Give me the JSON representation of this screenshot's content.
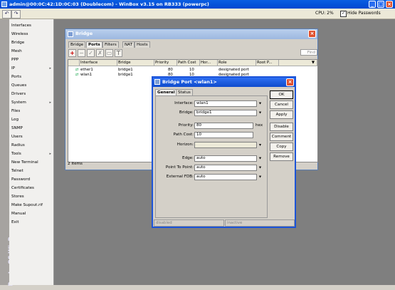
{
  "window": {
    "title": "admin@00:0C:42:1D:0C:03 (Doublecom) - WinBox v3.15 on RB333 (powerpc)",
    "min": "_",
    "max": "□",
    "close": "×"
  },
  "toolbar": {
    "back": "↶",
    "fwd": "↷",
    "cpu": "CPU: 2%",
    "hide_passwords_checked": "✓",
    "hide_passwords": "Hide Passwords"
  },
  "brand": "RouterOS WinBox",
  "menu": [
    {
      "label": "Interfaces",
      "arrow": ""
    },
    {
      "label": "Wireless",
      "arrow": ""
    },
    {
      "label": "Bridge",
      "arrow": ""
    },
    {
      "label": "Mesh",
      "arrow": ""
    },
    {
      "label": "PPP",
      "arrow": ""
    },
    {
      "label": "IP",
      "arrow": "▸"
    },
    {
      "label": "Ports",
      "arrow": ""
    },
    {
      "label": "Queues",
      "arrow": ""
    },
    {
      "label": "Drivers",
      "arrow": ""
    },
    {
      "label": "System",
      "arrow": "▸"
    },
    {
      "label": "Files",
      "arrow": ""
    },
    {
      "label": "Log",
      "arrow": ""
    },
    {
      "label": "SNMP",
      "arrow": ""
    },
    {
      "label": "Users",
      "arrow": ""
    },
    {
      "label": "Radius",
      "arrow": ""
    },
    {
      "label": "Tools",
      "arrow": "▸"
    },
    {
      "label": "New Terminal",
      "arrow": ""
    },
    {
      "label": "Telnet",
      "arrow": ""
    },
    {
      "label": "Password",
      "arrow": ""
    },
    {
      "label": "Certificates",
      "arrow": ""
    },
    {
      "label": "Stores",
      "arrow": ""
    },
    {
      "label": "Make Supout.rif",
      "arrow": ""
    },
    {
      "label": "Manual",
      "arrow": ""
    },
    {
      "label": "Exit",
      "arrow": ""
    }
  ],
  "bridge": {
    "title": "Bridge",
    "close": "×",
    "tabs": [
      "Bridge",
      "Ports",
      "Filters",
      "NAT",
      "Hosts"
    ],
    "active_tab": "Ports",
    "tools": {
      "add": "+",
      "remove": "−",
      "enable": "✓",
      "disable": "✗",
      "comment": "▭",
      "filter": "⊤"
    },
    "find": "Find",
    "columns": [
      "Interface",
      "Bridge",
      "Priority",
      "Path Cost",
      "Hor...",
      "Role",
      "Root P...",
      "▼"
    ],
    "rows": [
      {
        "interface": "ether1",
        "bridge": "bridge1",
        "priority": "80",
        "path_cost": "10",
        "horizon": "",
        "role": "designated port",
        "root": ""
      },
      {
        "interface": "wlan1",
        "bridge": "bridge1",
        "priority": "80",
        "path_cost": "10",
        "horizon": "",
        "role": "designated port",
        "root": ""
      }
    ],
    "items": "2 items"
  },
  "bridge_port": {
    "title": "Bridge Port <wlan1>",
    "close": "×",
    "tabs": [
      "General",
      "Status"
    ],
    "active_tab": "General",
    "fields": {
      "interface": {
        "label": "Interface:",
        "value": "wlan1"
      },
      "bridge": {
        "label": "Bridge:",
        "value": "bridge1"
      },
      "priority": {
        "label": "Priority:",
        "value": "80",
        "unit": "hex"
      },
      "path_cost": {
        "label": "Path Cost:",
        "value": "10"
      },
      "horizon": {
        "label": "Horizon:",
        "value": ""
      },
      "edge": {
        "label": "Edge:",
        "value": "auto"
      },
      "point_to_point": {
        "label": "Point To Point:",
        "value": "auto"
      },
      "external_fdb": {
        "label": "External FDB:",
        "value": "auto"
      }
    },
    "buttons": [
      "OK",
      "Cancel",
      "Apply",
      "Disable",
      "Comment",
      "Copy",
      "Remove"
    ],
    "status": [
      "disabled",
      "inactive"
    ]
  }
}
